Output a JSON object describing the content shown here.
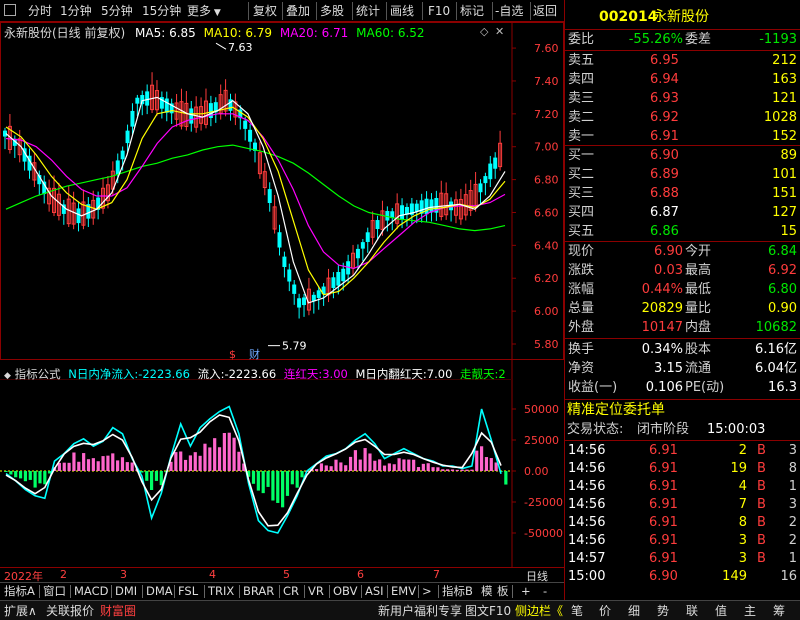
{
  "toolbar": {
    "left_items": [
      "分时",
      "1分钟",
      "5分钟",
      "15分钟",
      "更多"
    ],
    "right_items": [
      "复权",
      "叠加",
      "多股",
      "统计",
      "画线",
      "F10",
      "标记",
      "-自选",
      "返回"
    ]
  },
  "main_chart": {
    "stock_title": "永新股份(日线 前复权)",
    "ma5": "MA5: 6.85",
    "ma10": "MA10: 6.79",
    "ma20": "MA20: 6.71",
    "ma60": "MA60: 6.52",
    "price_axis": [
      "7.60",
      "7.40",
      "7.20",
      "7.00",
      "6.80",
      "6.60",
      "6.40",
      "6.20",
      "6.00",
      "5.80"
    ],
    "high_mark": "7.63",
    "low_mark": "5.79",
    "event_marks": [
      "$",
      "财"
    ]
  },
  "indicator": {
    "name": "指标公式",
    "n_label": "N日内净流入:",
    "n_value": "-2223.66",
    "flow_label": "流入:",
    "flow_value": "-2223.66",
    "red_days_label": "连红天:",
    "red_days_value": "3.00",
    "m_label": "M日内翻红天:",
    "m_value": "7.00",
    "strong_label": "走靓天:",
    "strong_value": "2",
    "axis": [
      "50000",
      "25000",
      "0.00",
      "-25000",
      "-50000"
    ]
  },
  "date_axis": [
    "2022年",
    "2",
    "3",
    "4",
    "5",
    "6",
    "7"
  ],
  "date_right": "日线",
  "tabs": [
    "指标A",
    "窗口",
    "MACD",
    "DMI",
    "DMA",
    "FSL",
    "TRIX",
    "BRAR",
    "CR",
    "VR",
    "OBV",
    "ASI",
    "EMV",
    ">",
    "指标B",
    "模",
    "板",
    "+",
    "-"
  ],
  "bottom_left": [
    "扩展∧",
    "关联报价",
    "财富圈"
  ],
  "bottom_right": [
    "新用户福利专享",
    "图文F10",
    "侧边栏《",
    "笔",
    "价",
    "细",
    "势",
    "联",
    "值",
    "主",
    "筹"
  ],
  "quote": {
    "code": "002014",
    "name": "永新股份",
    "wei_bi_label": "委比",
    "wei_bi": "-55.26%",
    "wei_cha_label": "委差",
    "wei_cha": "-1193",
    "asks": [
      {
        "label": "卖五",
        "price": "6.95",
        "vol": "212"
      },
      {
        "label": "卖四",
        "price": "6.94",
        "vol": "163"
      },
      {
        "label": "卖三",
        "price": "6.93",
        "vol": "121"
      },
      {
        "label": "卖二",
        "price": "6.92",
        "vol": "1028"
      },
      {
        "label": "卖一",
        "price": "6.91",
        "vol": "152"
      }
    ],
    "bids": [
      {
        "label": "买一",
        "price": "6.90",
        "vol": "89"
      },
      {
        "label": "买二",
        "price": "6.89",
        "vol": "101"
      },
      {
        "label": "买三",
        "price": "6.88",
        "vol": "151"
      },
      {
        "label": "买四",
        "price": "6.87",
        "vol": "127"
      },
      {
        "label": "买五",
        "price": "6.86",
        "vol": "15"
      }
    ],
    "stats": [
      {
        "l1": "现价",
        "v1": "6.90",
        "l2": "今开",
        "v2": "6.84"
      },
      {
        "l1": "涨跌",
        "v1": "0.03",
        "l2": "最高",
        "v2": "6.92"
      },
      {
        "l1": "涨幅",
        "v1": "0.44%",
        "l2": "最低",
        "v2": "6.80"
      },
      {
        "l1": "总量",
        "v1": "20829",
        "l2": "量比",
        "v2": "0.90"
      },
      {
        "l1": "外盘",
        "v1": "10147",
        "l2": "内盘",
        "v2": "10682"
      }
    ],
    "stats2": [
      {
        "l1": "换手",
        "v1": "0.34%",
        "l2": "股本",
        "v2": "6.16亿"
      },
      {
        "l1": "净资",
        "v1": "3.15",
        "l2": "流通",
        "v2": "6.04亿"
      },
      {
        "l1": "收益(一)",
        "v1": "0.106",
        "l2": "PE(动)",
        "v2": "16.3"
      }
    ],
    "precise_label": "精准定位委托单",
    "trade_state_label": "交易状态:",
    "trade_state": "闭市阶段",
    "trade_time": "15:00:03",
    "ticks": [
      {
        "time": "14:56",
        "price": "6.91",
        "vol": "2",
        "side": "B",
        "num": "3"
      },
      {
        "time": "14:56",
        "price": "6.91",
        "vol": "19",
        "side": "B",
        "num": "8"
      },
      {
        "time": "14:56",
        "price": "6.91",
        "vol": "4",
        "side": "B",
        "num": "1"
      },
      {
        "time": "14:56",
        "price": "6.91",
        "vol": "7",
        "side": "B",
        "num": "3"
      },
      {
        "time": "14:56",
        "price": "6.91",
        "vol": "8",
        "side": "B",
        "num": "2"
      },
      {
        "time": "14:56",
        "price": "6.91",
        "vol": "3",
        "side": "B",
        "num": "2"
      },
      {
        "time": "14:57",
        "price": "6.91",
        "vol": "3",
        "side": "B",
        "num": "1"
      },
      {
        "time": "15:00",
        "price": "6.90",
        "vol": "149",
        "side": "",
        "num": "16"
      }
    ]
  },
  "colors": {
    "up": "#ff3c3c",
    "down": "#00e600",
    "ma5": "#ffffff",
    "ma10": "#ffff00",
    "ma20": "#ff00ff",
    "ma60": "#00ff00",
    "grid": "#8b0000",
    "accent": "#ffff00"
  },
  "chart_data": [
    {
      "type": "line",
      "title": "永新股份(日线 前复权)",
      "ylim": [
        5.75,
        7.7
      ],
      "series": [
        {
          "name": "MA5",
          "values": [
            7.08,
            7.0,
            6.85,
            6.7,
            6.62,
            6.58,
            6.62,
            6.72,
            6.95,
            7.28,
            7.3,
            7.25,
            7.2,
            7.18,
            7.22,
            7.28,
            7.2,
            7.0,
            6.7,
            6.3,
            6.05,
            6.08,
            6.15,
            6.22,
            6.35,
            6.5,
            6.58,
            6.6,
            6.63,
            6.64,
            6.65,
            6.62,
            6.7,
            6.85
          ]
        },
        {
          "name": "MA10",
          "values": [
            7.12,
            7.06,
            6.95,
            6.82,
            6.72,
            6.65,
            6.62,
            6.66,
            6.8,
            7.05,
            7.2,
            7.22,
            7.2,
            7.2,
            7.22,
            7.24,
            7.18,
            7.05,
            6.85,
            6.55,
            6.25,
            6.1,
            6.12,
            6.2,
            6.3,
            6.42,
            6.52,
            6.58,
            6.62,
            6.63,
            6.65,
            6.63,
            6.68,
            6.79
          ]
        },
        {
          "name": "MA20",
          "values": [
            7.05,
            7.04,
            7.0,
            6.92,
            6.82,
            6.74,
            6.7,
            6.7,
            6.75,
            6.88,
            7.02,
            7.12,
            7.16,
            7.18,
            7.2,
            7.2,
            7.16,
            7.06,
            6.92,
            6.74,
            6.52,
            6.36,
            6.28,
            6.26,
            6.3,
            6.38,
            6.46,
            6.54,
            6.6,
            6.63,
            6.64,
            6.64,
            6.66,
            6.71
          ]
        },
        {
          "name": "MA60",
          "values": [
            6.62,
            6.66,
            6.7,
            6.73,
            6.76,
            6.78,
            6.8,
            6.82,
            6.85,
            6.88,
            6.9,
            6.93,
            6.95,
            6.98,
            7.0,
            7.01,
            6.99,
            6.97,
            6.94,
            6.9,
            6.84,
            6.77,
            6.7,
            6.64,
            6.6,
            6.58,
            6.56,
            6.55,
            6.54,
            6.52,
            6.5,
            6.49,
            6.5,
            6.52
          ]
        }
      ]
    },
    {
      "type": "bar",
      "title": "指标公式",
      "ylim": [
        -60000,
        60000
      ],
      "series": [
        {
          "name": "N日内净流入",
          "values": [
            -2000,
            -8000,
            -15000,
            -20000,
            -22000,
            8000,
            14000,
            22000,
            26000,
            20000,
            24000,
            35000,
            30000,
            10000,
            -4000,
            -38000,
            -18000,
            12000,
            38000,
            20000,
            35000,
            42000,
            48000,
            52000,
            30000,
            -10000,
            -40000,
            -48000,
            -50000,
            -36000,
            -20000,
            0,
            6000,
            12000,
            14000,
            18000,
            25000,
            30000,
            22000,
            10000,
            14000,
            18000,
            14000,
            10000,
            8000,
            4000,
            4000,
            2000,
            4000,
            50000,
            25000,
            -2223.66
          ]
        }
      ]
    }
  ]
}
